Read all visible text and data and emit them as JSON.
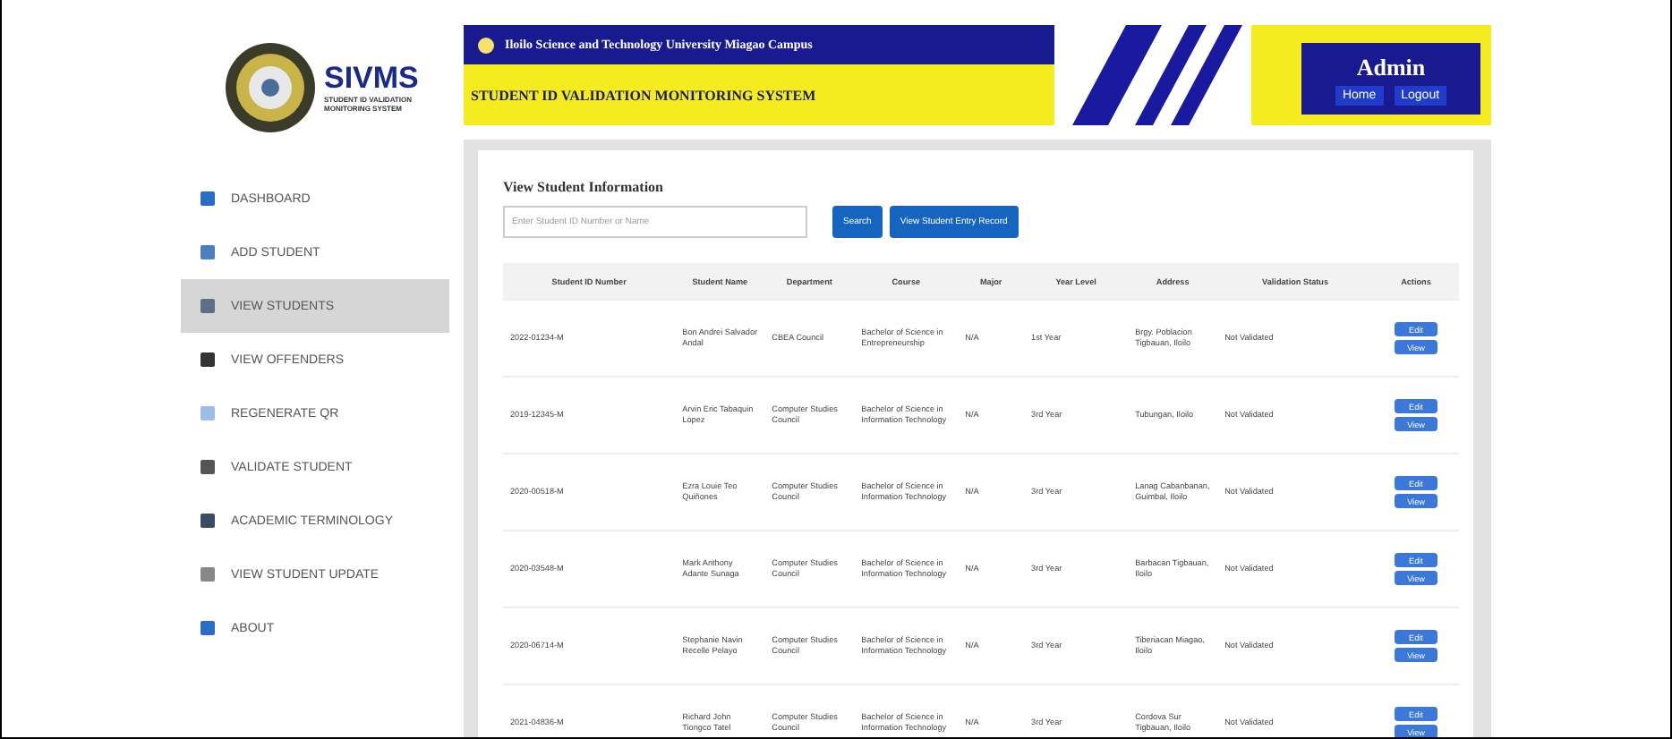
{
  "logo": {
    "title": "SIVMS",
    "subtitle": "STUDENT ID VALIDATION MONITORING SYSTEM"
  },
  "header": {
    "campus": "Iloilo Science and Technology University Miagao Campus",
    "system": "STUDENT ID VALIDATION MONITORING SYSTEM",
    "user": "Admin",
    "links": [
      "Home",
      "Logout"
    ]
  },
  "sidebar": {
    "items": [
      {
        "label": "DASHBOARD",
        "selected": false
      },
      {
        "label": "ADD STUDENT",
        "selected": false
      },
      {
        "label": "VIEW STUDENTS",
        "selected": true
      },
      {
        "label": "VIEW OFFENDERS",
        "selected": false
      },
      {
        "label": "REGENERATE QR",
        "selected": false
      },
      {
        "label": "VALIDATE STUDENT",
        "selected": false
      },
      {
        "label": "ACADEMIC TERMINOLOGY",
        "selected": false
      },
      {
        "label": "VIEW STUDENT UPDATE",
        "selected": false
      },
      {
        "label": "ABOUT",
        "selected": false
      }
    ]
  },
  "panel": {
    "title": "View Student Information",
    "search": {
      "placeholder": "Enter Student ID Number or Name"
    },
    "buttons": [
      "Search",
      "View Student Entry Record"
    ]
  },
  "table": {
    "columns": [
      "Student ID Number",
      "Student Name",
      "Department",
      "Course",
      "Major",
      "Year Level",
      "Address",
      "Validation Status",
      "Actions"
    ],
    "rows": [
      {
        "cells": [
          "2022-01234-M",
          "Bon Andrei Salvador Andal",
          "CBEA Council",
          "Bachelor of Science in Entrepreneurship",
          "N/A",
          "1st Year",
          "Brgy. Poblacion Tigbauan, Iloilo",
          "Not Validated"
        ],
        "actions": [
          "Edit",
          "View"
        ]
      },
      {
        "cells": [
          "2019-12345-M",
          "Arvin Eric Tabaquin Lopez",
          "Computer Studies Council",
          "Bachelor of Science in Information Technology",
          "N/A",
          "3rd Year",
          "Tubungan, Iloilo",
          "Not Validated"
        ],
        "actions": [
          "Edit",
          "View"
        ]
      },
      {
        "cells": [
          "2020-00518-M",
          "Ezra Louie Teo Quiñones",
          "Computer Studies Council",
          "Bachelor of Science in Information Technology",
          "N/A",
          "3rd Year",
          "Lanag Cabanbanan, Guimbal, Iloilo",
          "Not Validated"
        ],
        "actions": [
          "Edit",
          "View"
        ]
      },
      {
        "cells": [
          "2020-03548-M",
          "Mark Anthony Adante Sunaga",
          "Computer Studies Council",
          "Bachelor of Science in Information Technology",
          "N/A",
          "3rd Year",
          "Barbacan Tigbauan, Iloilo",
          "Not Validated"
        ],
        "actions": [
          "Edit",
          "View"
        ]
      },
      {
        "cells": [
          "2020-06714-M",
          "Stephanie Navin Recelle Pelayo",
          "Computer Studies Council",
          "Bachelor of Science in Information Technology",
          "N/A",
          "3rd Year",
          "Tiberiacan Miagao, Iloilo",
          "Not Validated"
        ],
        "actions": [
          "Edit",
          "View"
        ]
      },
      {
        "cells": [
          "2021-04836-M",
          "Richard John Tiongco Tatel",
          "Computer Studies Council",
          "Bachelor of Science in Information Technology",
          "N/A",
          "3rd Year",
          "Cordova Sur Tigbauan, Iloilo",
          "Not Validated"
        ],
        "actions": [
          "Edit",
          "View"
        ]
      }
    ]
  }
}
